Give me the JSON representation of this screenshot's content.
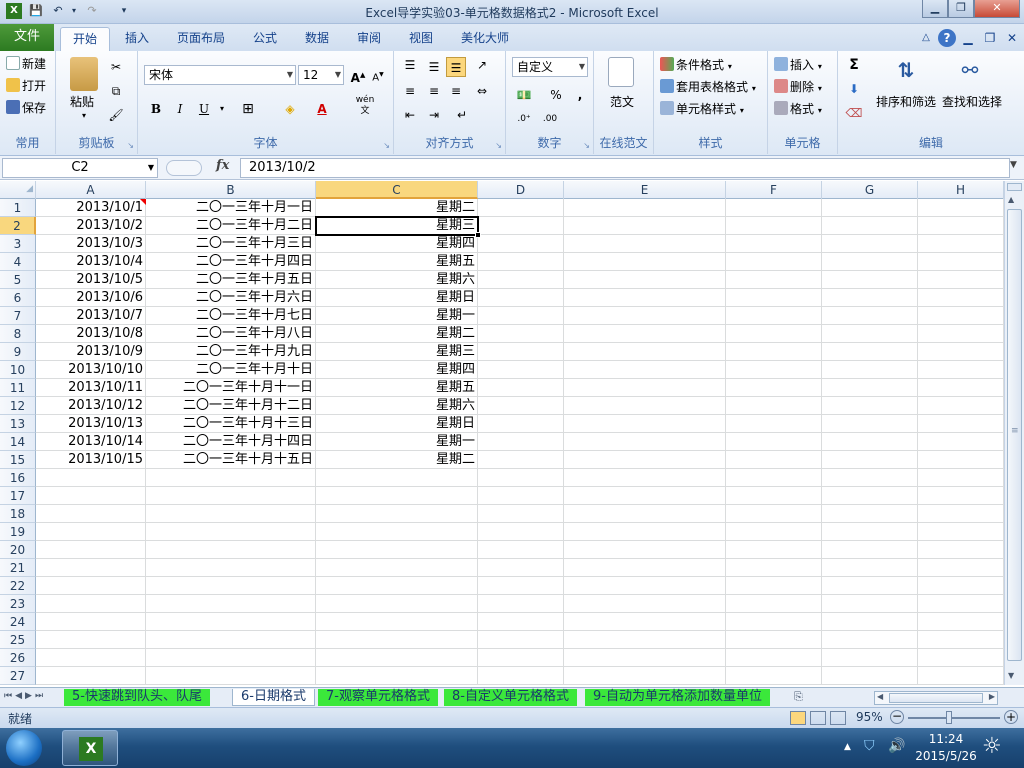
{
  "window": {
    "title": "Excel导学实验03-单元格数据格式2 - Microsoft Excel"
  },
  "ribbon": {
    "file_tab": "文件",
    "tabs": [
      "开始",
      "插入",
      "页面布局",
      "公式",
      "数据",
      "审阅",
      "视图",
      "美化大师"
    ],
    "common": {
      "new": "新建",
      "open": "打开",
      "save": "保存",
      "label": "常用"
    },
    "clipboard": {
      "paste": "粘贴",
      "label": "剪贴板"
    },
    "font": {
      "name": "宋体",
      "size": "12",
      "label": "字体",
      "bold": "B",
      "italic": "I",
      "underline": "U",
      "grow": "A",
      "shrink": "A",
      "color": "A",
      "wen": "wén\n文"
    },
    "alignment": {
      "label": "对齐方式"
    },
    "number": {
      "format": "自定义",
      "percent": "%",
      "comma": ",",
      "label": "数字"
    },
    "template": {
      "btn": "范文",
      "label": "在线范文"
    },
    "styles": {
      "conditional": "条件格式",
      "table": "套用表格格式",
      "cell_styles": "单元格样式",
      "label": "样式"
    },
    "cells": {
      "insert": "插入",
      "delete": "删除",
      "format": "格式",
      "label": "单元格"
    },
    "editing": {
      "sum": "Σ",
      "sort": "排序和筛选",
      "find": "查找和选择",
      "label": "编辑"
    }
  },
  "formula_bar": {
    "name_box": "C2",
    "fx": "fx",
    "content": "2013/10/2"
  },
  "grid": {
    "columns": [
      "A",
      "B",
      "C",
      "D",
      "E",
      "F",
      "G",
      "H"
    ],
    "selected_column": "C",
    "selected_row": 2,
    "row_numbers": [
      "1",
      "2",
      "3",
      "4",
      "5",
      "6",
      "7",
      "8",
      "9",
      "10",
      "11",
      "12",
      "13",
      "14",
      "15",
      "16",
      "17",
      "18",
      "19",
      "20",
      "21",
      "22",
      "23",
      "24",
      "25",
      "26",
      "27"
    ],
    "rows": [
      {
        "a": "2013/10/1",
        "b": "二〇一三年十月一日",
        "c": "星期二"
      },
      {
        "a": "2013/10/2",
        "b": "二〇一三年十月二日",
        "c": "星期三"
      },
      {
        "a": "2013/10/3",
        "b": "二〇一三年十月三日",
        "c": "星期四"
      },
      {
        "a": "2013/10/4",
        "b": "二〇一三年十月四日",
        "c": "星期五"
      },
      {
        "a": "2013/10/5",
        "b": "二〇一三年十月五日",
        "c": "星期六"
      },
      {
        "a": "2013/10/6",
        "b": "二〇一三年十月六日",
        "c": "星期日"
      },
      {
        "a": "2013/10/7",
        "b": "二〇一三年十月七日",
        "c": "星期一"
      },
      {
        "a": "2013/10/8",
        "b": "二〇一三年十月八日",
        "c": "星期二"
      },
      {
        "a": "2013/10/9",
        "b": "二〇一三年十月九日",
        "c": "星期三"
      },
      {
        "a": "2013/10/10",
        "b": "二〇一三年十月十日",
        "c": "星期四"
      },
      {
        "a": "2013/10/11",
        "b": "二〇一三年十月十一日",
        "c": "星期五"
      },
      {
        "a": "2013/10/12",
        "b": "二〇一三年十月十二日",
        "c": "星期六"
      },
      {
        "a": "2013/10/13",
        "b": "二〇一三年十月十三日",
        "c": "星期日"
      },
      {
        "a": "2013/10/14",
        "b": "二〇一三年十月十四日",
        "c": "星期一"
      },
      {
        "a": "2013/10/15",
        "b": "二〇一三年十月十五日",
        "c": "星期二"
      }
    ]
  },
  "sheet_tabs": [
    {
      "label": "5-快速跳到队头、队尾",
      "style": "green"
    },
    {
      "label": "6-日期格式",
      "style": "active"
    },
    {
      "label": "7-观察单元格格式",
      "style": "green"
    },
    {
      "label": "8-自定义单元格格式",
      "style": "green"
    },
    {
      "label": "9-自动为单元格添加数量单位",
      "style": "green"
    }
  ],
  "status_bar": {
    "ready": "就绪",
    "zoom": "95%"
  },
  "taskbar": {
    "time": "11:24",
    "date": "2015/5/26"
  },
  "colors": {
    "accent": "#2c7a21",
    "selected_header": "#f9d77e",
    "sheet_tab_green": "#3be83b"
  }
}
